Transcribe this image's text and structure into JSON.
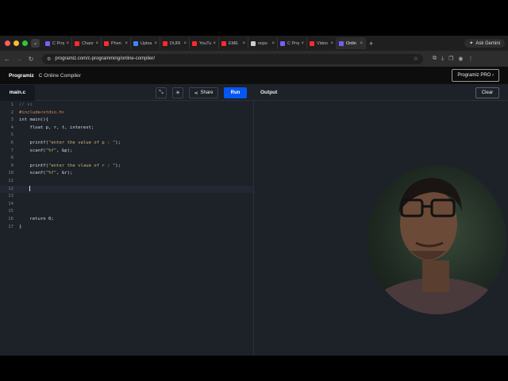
{
  "browser": {
    "tabs": [
      {
        "label": "C Prog",
        "fav_color": "#7b5cff"
      },
      {
        "label": "Chann",
        "fav_color": "#ff2a2a"
      },
      {
        "label": "Phen",
        "fav_color": "#ff2a2a"
      },
      {
        "label": "Uploa",
        "fav_color": "#4285f4"
      },
      {
        "label": "DURI",
        "fav_color": "#ff2a2a"
      },
      {
        "label": "YouTu",
        "fav_color": "#ff2a2a"
      },
      {
        "label": "EME",
        "fav_color": "#ff2a2a"
      },
      {
        "label": "oops",
        "fav_color": "#cccccc"
      },
      {
        "label": "C Prog",
        "fav_color": "#7b5cff"
      },
      {
        "label": "Video",
        "fav_color": "#ff2a2a"
      },
      {
        "label": "Onlin",
        "fav_color": "#7b5cff",
        "active": true
      }
    ],
    "ask_gemini": "Ask Gemini",
    "url": "programiz.com/c-programming/online-compiler/"
  },
  "app": {
    "brand": "Programiz",
    "title": "C Online Compiler",
    "pro_button": "Programiz PRO ›"
  },
  "editor_bar": {
    "file_tab": "main.c",
    "share": "Share",
    "run": "Run",
    "output": "Output",
    "clear": "Clear"
  },
  "code": [
    {
      "n": "1",
      "text": "// si",
      "type": "comment"
    },
    {
      "n": "2",
      "text": "#include<stdio.h>",
      "type": "include"
    },
    {
      "n": "3",
      "text": "int main(){",
      "type": "plain"
    },
    {
      "n": "4",
      "text": "    float p, r, t, interest;",
      "type": "plain"
    },
    {
      "n": "5",
      "text": "",
      "type": "plain"
    },
    {
      "n": "6",
      "pre": "    printf(",
      "str": "\"enter the value of p : \"",
      "post": ");",
      "type": "string"
    },
    {
      "n": "7",
      "pre": "    scanf(",
      "str": "\"%f\"",
      "post": ", &p);",
      "type": "string"
    },
    {
      "n": "8",
      "text": "",
      "type": "plain"
    },
    {
      "n": "9",
      "pre": "    printf(",
      "str": "\"enter the vlaue of r : \"",
      "post": ");",
      "type": "string"
    },
    {
      "n": "10",
      "pre": "    scanf(",
      "str": "\"%f\"",
      "post": ", &r);",
      "type": "string"
    },
    {
      "n": "11",
      "text": "",
      "type": "plain"
    },
    {
      "n": "12",
      "text": "    ",
      "type": "cursor"
    },
    {
      "n": "13",
      "text": "",
      "type": "plain"
    },
    {
      "n": "14",
      "text": "",
      "type": "plain"
    },
    {
      "n": "15",
      "text": "",
      "type": "plain"
    },
    {
      "n": "16",
      "text": "    return 0;",
      "type": "plain"
    },
    {
      "n": "17",
      "text": "}",
      "type": "plain"
    }
  ]
}
